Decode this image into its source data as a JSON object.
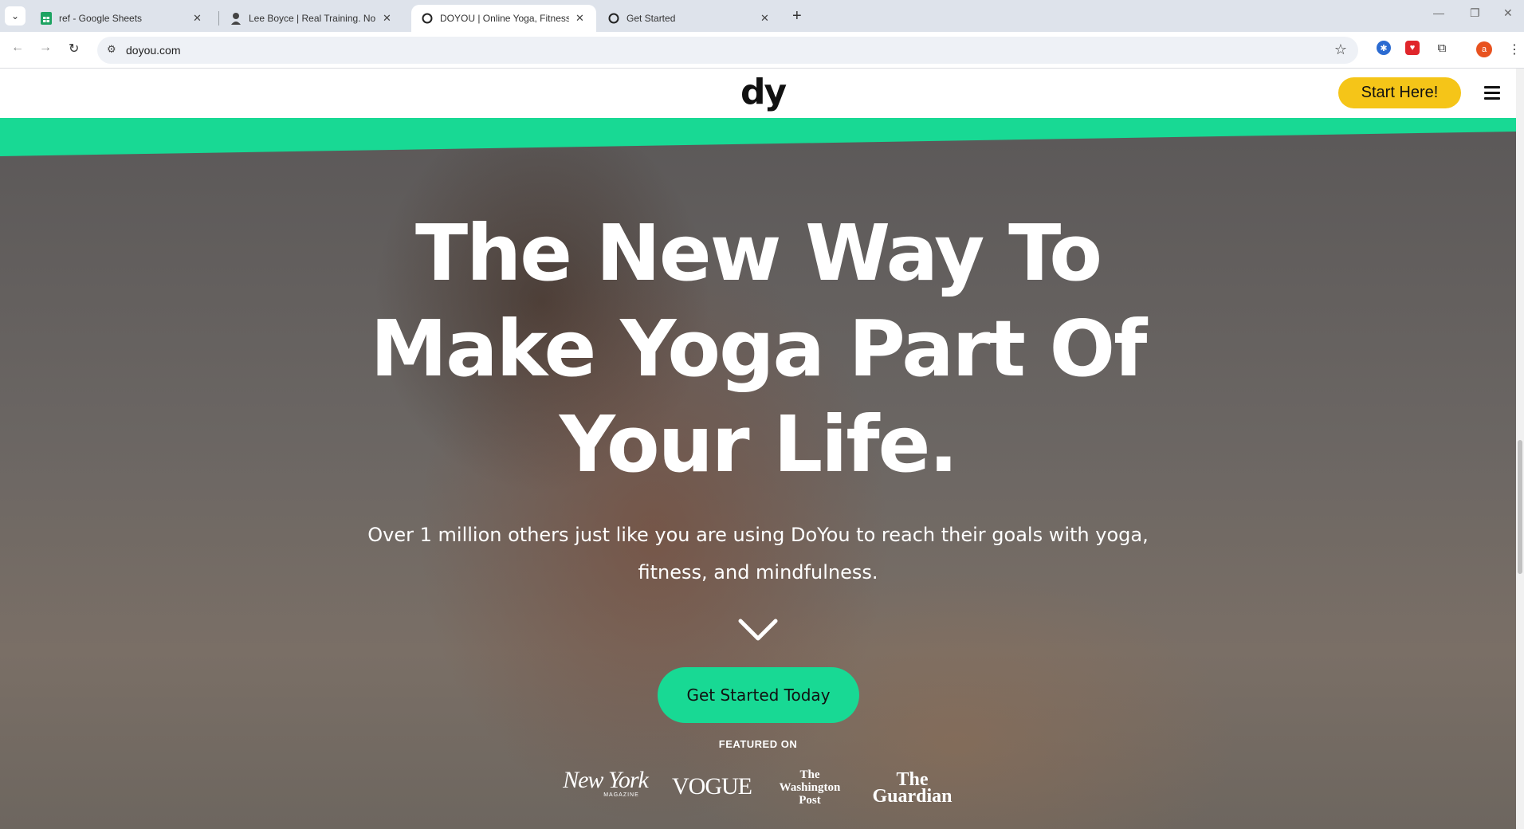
{
  "browser": {
    "tabs": [
      {
        "title": "ref - Google Sheets",
        "icon": "google-sheets-icon",
        "active": false
      },
      {
        "title": "Lee Boyce | Real Training. No N",
        "icon": "person-icon",
        "active": false
      },
      {
        "title": "DOYOU | Online Yoga, Fitness, &",
        "icon": "globe-icon",
        "active": true
      },
      {
        "title": "Get Started",
        "icon": "globe-icon",
        "active": false
      }
    ],
    "url": "doyou.com",
    "profile_initial": "a"
  },
  "site": {
    "logo": "dy",
    "start_button": "Start Here!",
    "accent_color": "#18d994",
    "button_yellow": "#f5c518"
  },
  "hero": {
    "headline": "The New Way To Make Yoga Part Of Your Life.",
    "subtext": "Over 1 million others just like you are using DoYou to reach their goals with yoga, fitness, and mindfulness.",
    "cta": "Get Started Today",
    "featured_label": "FEATURED ON",
    "press": [
      {
        "name": "New York",
        "sub": "MAGAZINE"
      },
      {
        "name": "VOGUE"
      },
      {
        "name": "The Washington Post"
      },
      {
        "name": "The Guardian"
      }
    ]
  }
}
